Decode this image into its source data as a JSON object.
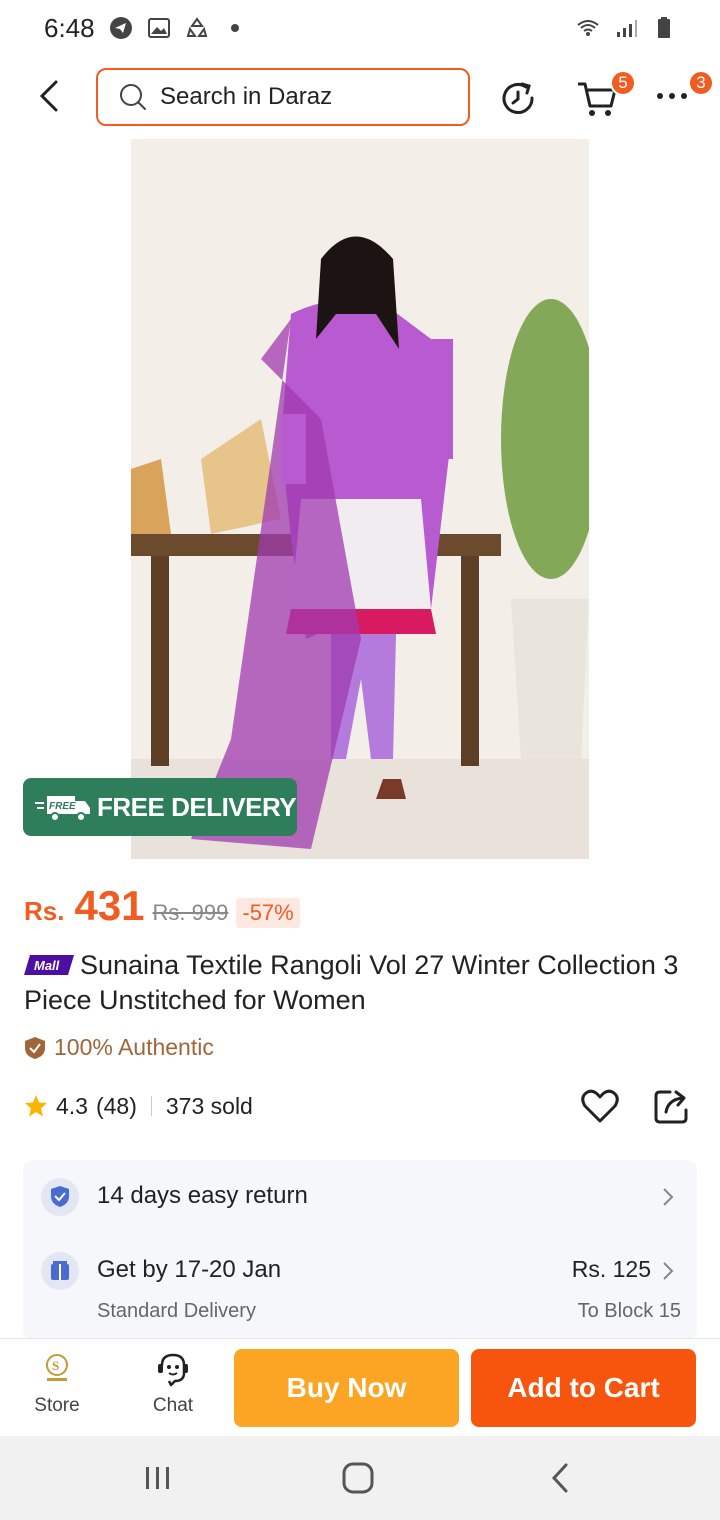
{
  "status_bar": {
    "time": "6:48"
  },
  "top_bar": {
    "search_placeholder": "Search in Daraz",
    "cart_count": "5",
    "more_count": "3"
  },
  "product": {
    "free_delivery_tag": "FREE",
    "free_delivery_label": "FREE DELIVERY",
    "price_currency": "Rs.",
    "price_value": "431",
    "price_old": "Rs. 999",
    "discount": "-57%",
    "mall_badge": "Mall",
    "title": "Sunaina Textile Rangoli Vol 27 Winter Collection 3 Piece Unstitched for Women",
    "authentic": "100% Authentic",
    "rating": "4.3",
    "rating_count": "(48)",
    "sold": "373 sold"
  },
  "delivery": {
    "return_text": "14 days easy return",
    "get_by": "Get by 17-20 Jan",
    "method": "Standard Delivery",
    "fee": "Rs. 125",
    "destination": "To Block 15"
  },
  "actions": {
    "store": "Store",
    "chat": "Chat",
    "buy_now": "Buy Now",
    "add_to_cart": "Add to Cart"
  },
  "colors": {
    "accent": "#f15c22",
    "buy_now": "#fca524",
    "add_to_cart": "#f7550e",
    "free_delivery": "#2e7d5b"
  }
}
